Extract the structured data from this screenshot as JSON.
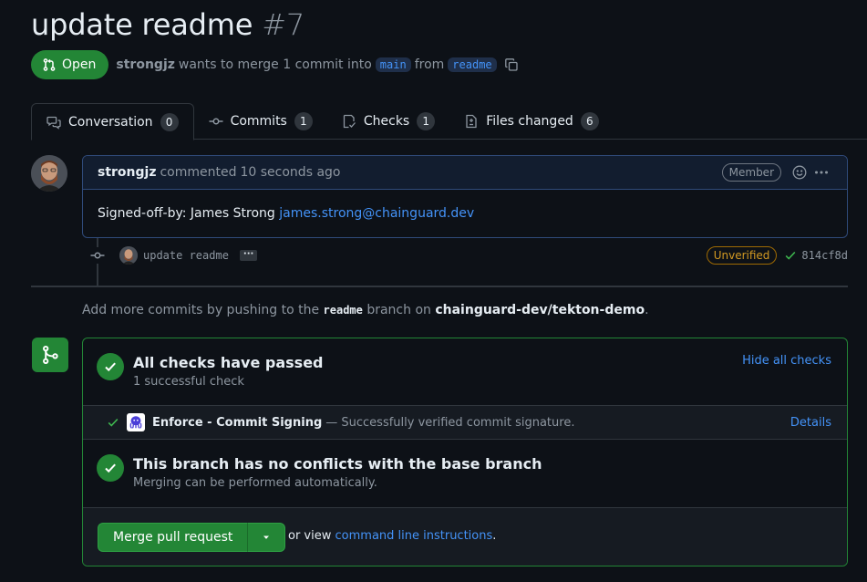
{
  "pr": {
    "title": "update readme",
    "number": "#7",
    "state": "Open",
    "author": "strongjz",
    "merge_text": "wants to merge 1 commit into",
    "base_branch": "main",
    "from_text": "from",
    "head_branch": "readme"
  },
  "tabs": [
    {
      "label": "Conversation",
      "count": "0",
      "icon": "comment-discussion-icon"
    },
    {
      "label": "Commits",
      "count": "1",
      "icon": "git-commit-icon"
    },
    {
      "label": "Checks",
      "count": "1",
      "icon": "checklist-icon"
    },
    {
      "label": "Files changed",
      "count": "6",
      "icon": "file-diff-icon"
    }
  ],
  "comment": {
    "author": "strongjz",
    "action": "commented",
    "time": "10 seconds ago",
    "badge": "Member",
    "body_prefix": "Signed-off-by: James Strong",
    "body_email": "james.strong@chainguard.dev"
  },
  "commit": {
    "message": "update readme",
    "ellipsis": "···",
    "verification": "Unverified",
    "sha": "814cf8d"
  },
  "push_hint": {
    "prefix": "Add more commits by pushing to the",
    "branch": "readme",
    "middle": "branch on",
    "repo": "chainguard-dev/tekton-demo",
    "suffix": "."
  },
  "checks": {
    "title": "All checks have passed",
    "subtitle": "1 successful check",
    "toggle": "Hide all checks",
    "items": [
      {
        "name": "Enforce - Commit Signing",
        "description": "— Successfully verified commit signature.",
        "action": "Details"
      }
    ]
  },
  "conflicts": {
    "title": "This branch has no conflicts with the base branch",
    "subtitle": "Merging can be performed automatically."
  },
  "merge": {
    "button": "Merge pull request",
    "or_view": "or view",
    "cli_link": "command line instructions",
    "period": "."
  },
  "colors": {
    "background": "#0d1117",
    "success": "#238636",
    "link": "#4493f8",
    "muted": "#8d96a0",
    "warning": "#d29922"
  }
}
